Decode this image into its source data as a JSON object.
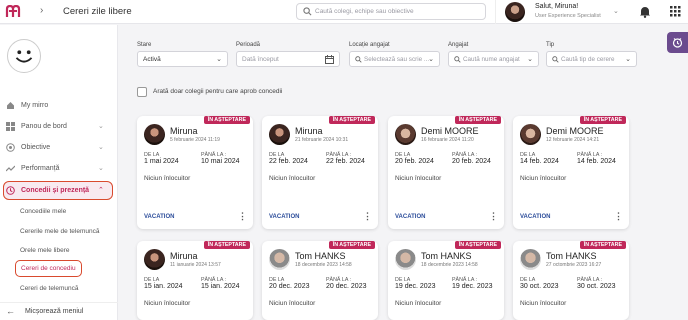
{
  "header": {
    "title": "Cereri zile libere",
    "search_placeholder": "Caută colegi, echipe sau obiective",
    "user_name": "Salut, Miruna!",
    "user_role": "User Experience Specialist"
  },
  "sidebar": {
    "items": [
      {
        "label": "My mirro"
      },
      {
        "label": "Panou de bord"
      },
      {
        "label": "Obiective"
      },
      {
        "label": "Performanță"
      },
      {
        "label": "Concedii și prezență"
      }
    ],
    "subitems": [
      {
        "label": "Concediile mele"
      },
      {
        "label": "Cererile mele de telemuncă"
      },
      {
        "label": "Orele mele libere"
      },
      {
        "label": "Cereri de concediu"
      },
      {
        "label": "Cereri de telemuncă"
      }
    ],
    "collapse_label": "Micșorează meniul"
  },
  "filters": {
    "stare_label": "Stare",
    "stare_value": "Activă",
    "perioada_label": "Perioadă",
    "perioada_placeholder": "Dată început",
    "locatie_label": "Locație angajat",
    "locatie_placeholder": "Selectează sau scrie ...",
    "angajat_label": "Angajat",
    "angajat_placeholder": "Caută nume angajat",
    "tip_label": "Tip",
    "tip_placeholder": "Caută tip de cerere",
    "checkbox_label": "Arată doar colegii pentru care aprob concedii"
  },
  "cards": [
    {
      "badge": "ÎN AȘTEPTARE",
      "name": "Miruna",
      "created": "5 februarie 2024 11:19",
      "from_label": "DE LA",
      "from": "1 mai 2024",
      "to_label": "PÂNĂ LA :",
      "to": "10 mai 2024",
      "replacement": "Niciun înlocuitor",
      "type": "VACATION"
    },
    {
      "badge": "ÎN AȘTEPTARE",
      "name": "Miruna",
      "created": "21 februarie 2024 10:31",
      "from_label": "DE LA",
      "from": "22 feb. 2024",
      "to_label": "PÂNĂ LA :",
      "to": "22 feb. 2024",
      "replacement": "Niciun înlocuitor",
      "type": "VACATION"
    },
    {
      "badge": "ÎN AȘTEPTARE",
      "name": "Demi MOORE",
      "created": "16 februarie 2024 11:20",
      "from_label": "DE LA",
      "from": "20 feb. 2024",
      "to_label": "PÂNĂ LA :",
      "to": "20 feb. 2024",
      "replacement": "Niciun înlocuitor",
      "type": "VACATION"
    },
    {
      "badge": "ÎN AȘTEPTARE",
      "name": "Demi MOORE",
      "created": "12 februarie 2024 14:21",
      "from_label": "DE LA",
      "from": "14 feb. 2024",
      "to_label": "PÂNĂ LA :",
      "to": "14 feb. 2024",
      "replacement": "Niciun înlocuitor",
      "type": "VACATION"
    },
    {
      "badge": "ÎN AȘTEPTARE",
      "name": "Miruna",
      "created": "11 ianuarie 2024 13:57",
      "from_label": "DE LA",
      "from": "15 ian. 2024",
      "to_label": "PÂNĂ LA :",
      "to": "15 ian. 2024",
      "replacement": "Niciun înlocuitor",
      "type": ""
    },
    {
      "badge": "ÎN AȘTEPTARE",
      "name": "Tom HANKS",
      "created": "18 decembrie 2023 14:58",
      "from_label": "DE LA",
      "from": "20 dec. 2023",
      "to_label": "PÂNĂ LA :",
      "to": "20 dec. 2023",
      "replacement": "Niciun înlocuitor",
      "type": ""
    },
    {
      "badge": "ÎN AȘTEPTARE",
      "name": "Tom HANKS",
      "created": "18 decembrie 2023 14:58",
      "from_label": "DE LA",
      "from": "19 dec. 2023",
      "to_label": "PÂNĂ LA :",
      "to": "19 dec. 2023",
      "replacement": "Niciun înlocuitor",
      "type": ""
    },
    {
      "badge": "ÎN AȘTEPTARE",
      "name": "Tom HANKS",
      "created": "27 octombrie 2023 16:27",
      "from_label": "DE LA",
      "from": "30 oct. 2023",
      "to_label": "PÂNĂ LA :",
      "to": "30 oct. 2023",
      "replacement": "Niciun înlocuitor",
      "type": ""
    }
  ],
  "colors": {
    "accent": "#c0285a",
    "highlight": "#d94a2e",
    "link": "#2b4c9a"
  }
}
